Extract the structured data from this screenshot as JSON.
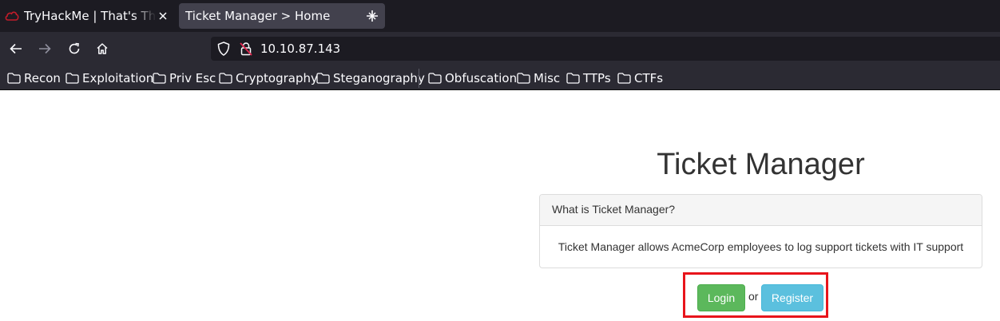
{
  "browser": {
    "tabs": [
      {
        "title": "TryHackMe | That's The Ti",
        "favicon": "tryhackme-cloud-icon",
        "active": false
      },
      {
        "title": "Ticket Manager > Home",
        "favicon": "",
        "active": true
      }
    ],
    "url": "10.10.87.143",
    "bookmarks": [
      {
        "label": "Recon"
      },
      {
        "label": "Exploitation"
      },
      {
        "label": "Priv Esc"
      },
      {
        "label": "Cryptography"
      },
      {
        "label": "Steganography"
      },
      {
        "label": "Obfuscation"
      },
      {
        "label": "Misc"
      },
      {
        "label": "TTPs"
      },
      {
        "label": "CTFs"
      }
    ],
    "colors": {
      "tabbar": "#1c1b22",
      "toolbar": "#2b2a33",
      "active_tab": "#42414d"
    }
  },
  "page": {
    "title": "Ticket Manager",
    "panel": {
      "heading": "What is Ticket Manager?",
      "body": "Ticket Manager allows AcmeCorp employees to log support tickets with IT support"
    },
    "actions": {
      "login_label": "Login",
      "separator": "or",
      "register_label": "Register"
    },
    "colors": {
      "login": "#5cb85c",
      "register": "#5bc0de",
      "highlight": "#e8141b"
    }
  }
}
